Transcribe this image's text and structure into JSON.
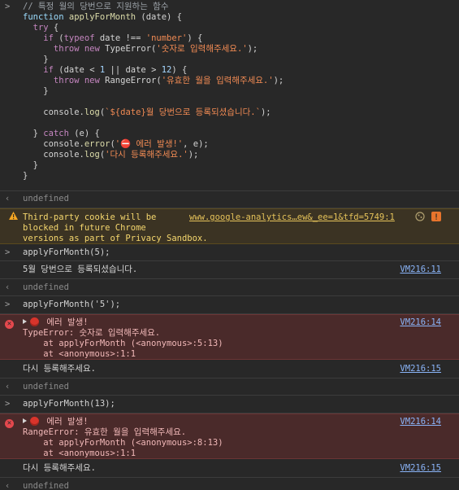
{
  "code": {
    "lines": [
      [
        {
          "t": "// 특정 월의 당번으로 지원하는 함수",
          "c": "cmt"
        }
      ],
      [
        {
          "t": "function ",
          "c": "kw2"
        },
        {
          "t": "applyForMonth",
          "c": "fn"
        },
        {
          "t": " (date) {",
          "c": "ty"
        }
      ],
      [
        {
          "t": "  try",
          "c": "kw"
        },
        {
          "t": " {",
          "c": "ty"
        }
      ],
      [
        {
          "t": "    if",
          "c": "kw"
        },
        {
          "t": " (",
          "c": "ty"
        },
        {
          "t": "typeof",
          "c": "kw"
        },
        {
          "t": " date !== ",
          "c": "ty"
        },
        {
          "t": "'number'",
          "c": "str"
        },
        {
          "t": ") {",
          "c": "ty"
        }
      ],
      [
        {
          "t": "      throw new ",
          "c": "kw"
        },
        {
          "t": "TypeError(",
          "c": "ty"
        },
        {
          "t": "'숫자로 입력해주세요.'",
          "c": "str"
        },
        {
          "t": ");",
          "c": "ty"
        }
      ],
      [
        {
          "t": "    }",
          "c": "ty"
        }
      ],
      [
        {
          "t": "    if",
          "c": "kw"
        },
        {
          "t": " (date < ",
          "c": "ty"
        },
        {
          "t": "1",
          "c": "num"
        },
        {
          "t": " || date > ",
          "c": "ty"
        },
        {
          "t": "12",
          "c": "num"
        },
        {
          "t": ") {",
          "c": "ty"
        }
      ],
      [
        {
          "t": "      throw new ",
          "c": "kw"
        },
        {
          "t": "RangeError(",
          "c": "ty"
        },
        {
          "t": "'유효한 월을 입력해주세요.'",
          "c": "str"
        },
        {
          "t": ");",
          "c": "ty"
        }
      ],
      [
        {
          "t": "    }",
          "c": "ty"
        }
      ],
      [
        {
          "t": "",
          "c": "ty"
        }
      ],
      [
        {
          "t": "    console.",
          "c": "ty"
        },
        {
          "t": "log",
          "c": "fn"
        },
        {
          "t": "(",
          "c": "ty"
        },
        {
          "t": "`${date}월 당번으로 등록되셨습니다.`",
          "c": "str"
        },
        {
          "t": ");",
          "c": "ty"
        }
      ],
      [
        {
          "t": "",
          "c": "ty"
        }
      ],
      [
        {
          "t": "  } ",
          "c": "ty"
        },
        {
          "t": "catch",
          "c": "kw"
        },
        {
          "t": " (e) {",
          "c": "ty"
        }
      ],
      [
        {
          "t": "    console.",
          "c": "ty"
        },
        {
          "t": "error",
          "c": "fn"
        },
        {
          "t": "(",
          "c": "ty"
        },
        {
          "t": "'⛔ 에러 발생!'",
          "c": "str"
        },
        {
          "t": ", e);",
          "c": "ty"
        }
      ],
      [
        {
          "t": "    console.",
          "c": "ty"
        },
        {
          "t": "log",
          "c": "fn"
        },
        {
          "t": "(",
          "c": "ty"
        },
        {
          "t": "'다시 등록해주세요.'",
          "c": "str"
        },
        {
          "t": ");",
          "c": "ty"
        }
      ],
      [
        {
          "t": "  }",
          "c": "ty"
        }
      ],
      [
        {
          "t": "}",
          "c": "ty"
        }
      ]
    ]
  },
  "entries": {
    "undefined1": "undefined",
    "warning": {
      "text": "Third-party cookie will be\nblocked in future Chrome\nversions as part of Privacy Sandbox.",
      "link": "www.google-analytics…ew&_ee=1&tfd=5749:1"
    },
    "cmd1": "applyForMonth(5);",
    "log1": {
      "text": "5월 당번으로 등록되셨습니다.",
      "loc": "VM216:11"
    },
    "undefined2": "undefined",
    "cmd2": "applyForMonth('5');",
    "err1": {
      "head": "에러 발생!",
      "body": "TypeError: 숫자로 입력해주세요.\n    at applyForMonth (<anonymous>:5:13)\n    at <anonymous>:1:1",
      "loc": "VM216:14"
    },
    "log2": {
      "text": "다시 등록해주세요.",
      "loc": "VM216:15"
    },
    "undefined3": "undefined",
    "cmd3": "applyForMonth(13);",
    "err2": {
      "head": "에러 발생!",
      "body": "RangeError: 유효한 월을 입력해주세요.\n    at applyForMonth (<anonymous>:8:13)\n    at <anonymous>:1:1",
      "loc": "VM216:14"
    },
    "log3": {
      "text": "다시 등록해주세요.",
      "loc": "VM216:15"
    },
    "undefined4": "undefined"
  },
  "glyphs": {
    "prompt": ">",
    "result": "‹",
    "error_x": "✕"
  },
  "colors": {
    "background": "#282828",
    "warning_bg": "#3b3323",
    "error_bg": "#4a2a2a",
    "link": "#8ab4f8",
    "string": "#f28b54"
  }
}
